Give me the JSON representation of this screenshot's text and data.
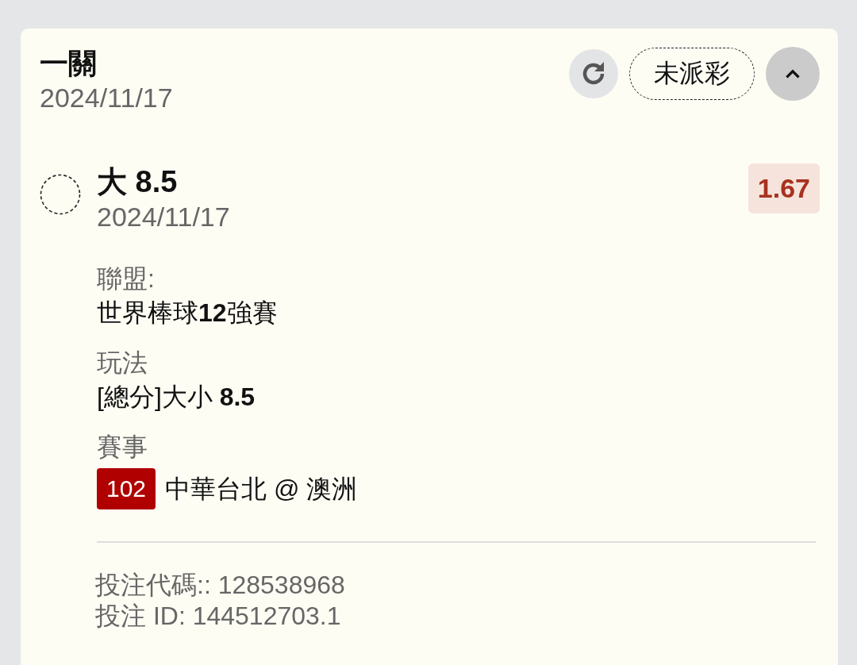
{
  "card": {
    "title": "一關",
    "date": "2024/11/17",
    "status": "未派彩",
    "expanded": true
  },
  "selection": {
    "name": "大 8.5",
    "date": "2024/11/17",
    "odds": "1.67"
  },
  "details": [
    {
      "kind": "text",
      "label": "聯盟:",
      "value": "世界棒球**12**強賽"
    },
    {
      "kind": "text",
      "label": "玩法",
      "value": "[總分]大小 **8.5**"
    },
    {
      "kind": "event",
      "label": "賽事",
      "badge": "102",
      "value": "中華台北 @ 澳洲"
    }
  ],
  "footer": [
    "投注代碼:: 128538968",
    "投注 ID: 144512703.1"
  ]
}
